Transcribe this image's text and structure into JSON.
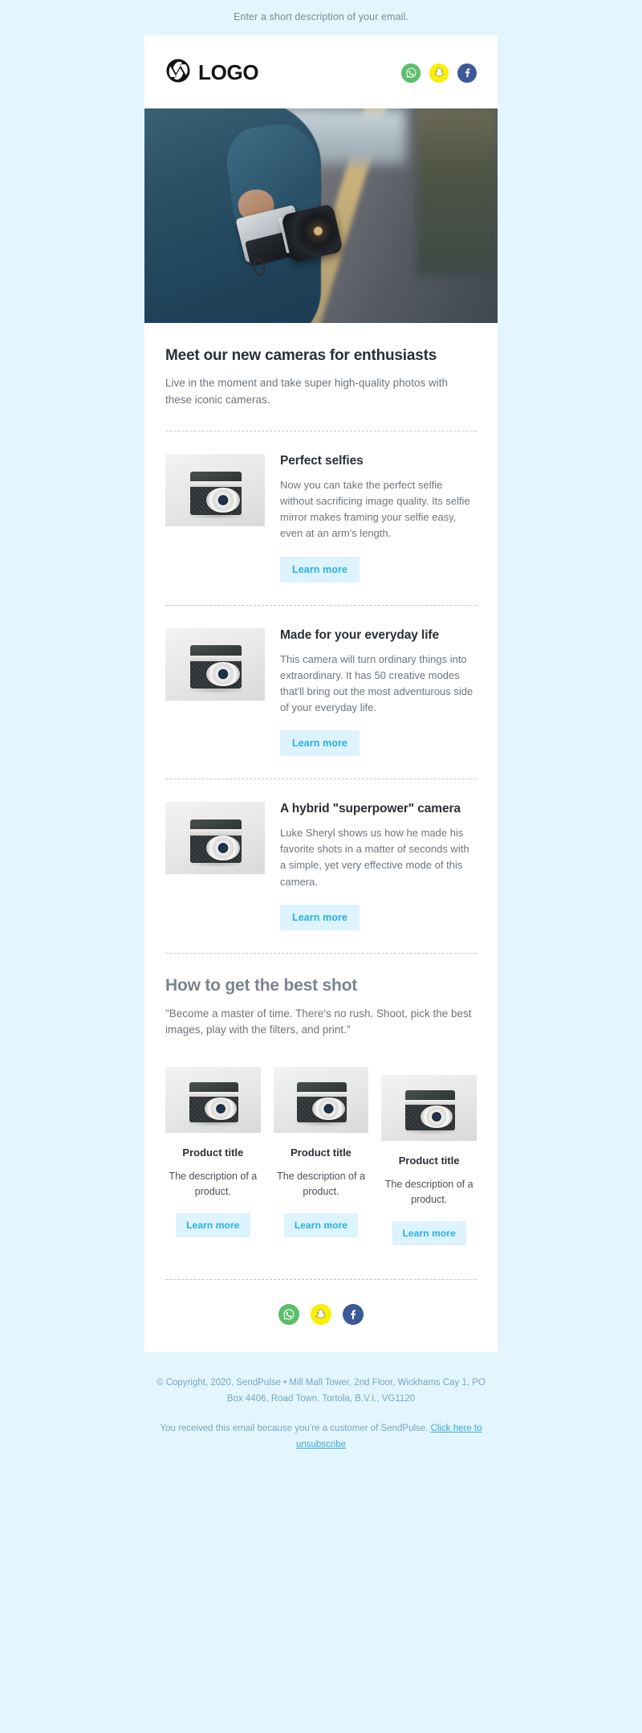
{
  "preheader": "Enter a short description of your email.",
  "header": {
    "logo_text": "LOGO",
    "logo_icon": "camera-shutter-icon",
    "socials": [
      {
        "name": "whatsapp",
        "label": "WhatsApp",
        "color": "#5cbe6b"
      },
      {
        "name": "snapchat",
        "label": "Snapchat",
        "color": "#f7f000"
      },
      {
        "name": "facebook",
        "label": "Facebook",
        "color": "#3b5998"
      }
    ]
  },
  "hero": {
    "alt": "Person in denim jacket holding a film camera on a road"
  },
  "intro": {
    "title": "Meet our new cameras for enthusiasts",
    "text": "Live in the moment and take super high-quality photos with these iconic cameras."
  },
  "features": [
    {
      "title": "Perfect selfies",
      "text": "Now you can take the perfect selfie without sacrificing image quality. Its selfie mirror makes framing your selfie easy, even at an arm's length.",
      "button": "Learn more"
    },
    {
      "title": "Made for your everyday life",
      "text": "This camera will turn ordinary things into extraordinary. It has 50 creative modes that'll bring out the most adventurous side of your everyday life.",
      "button": "Learn more"
    },
    {
      "title": "A hybrid \"superpower\" camera",
      "text": "Luke Sheryl shows us how he made his favorite shots in a matter of seconds with a simple, yet very effective mode of this camera.",
      "button": "Learn more"
    }
  ],
  "bestshot": {
    "title": "How to get the best shot",
    "quote": "\"Become a master of time. There's no rush. Shoot, pick the best images, play with the filters, and print.\""
  },
  "products": [
    {
      "title": "Product title",
      "description": "The description of a product.",
      "button": "Learn more"
    },
    {
      "title": "Product title",
      "description": "The description of a product.",
      "button": "Learn more"
    },
    {
      "title": "Product title",
      "description": "The description of a product.",
      "button": "Learn more"
    }
  ],
  "footer": {
    "socials": [
      {
        "name": "whatsapp",
        "label": "WhatsApp",
        "color": "#5cbe6b"
      },
      {
        "name": "snapchat",
        "label": "Snapchat",
        "color": "#f7f000"
      },
      {
        "name": "facebook",
        "label": "Facebook",
        "color": "#3b5998"
      }
    ],
    "copyright": "© Copyright, 2020, SendPulse • Mill Mall Tower, 2nd Floor, Wickhams Cay 1, PO Box 4406, Road Town, Tortola, B.V.I., VG1120",
    "reason_text": "You received this email because you’re a customer of SendPulse. ",
    "reason_link": "Click here to unsubscribe"
  },
  "colors": {
    "page_bg": "#e3f6fd",
    "card_bg": "#ffffff",
    "accent": "#28b0e8",
    "button_bg": "#ddf3fd",
    "heading": "#2b3035",
    "body_text": "#6d757c",
    "legal_text": "#73a6c4"
  }
}
